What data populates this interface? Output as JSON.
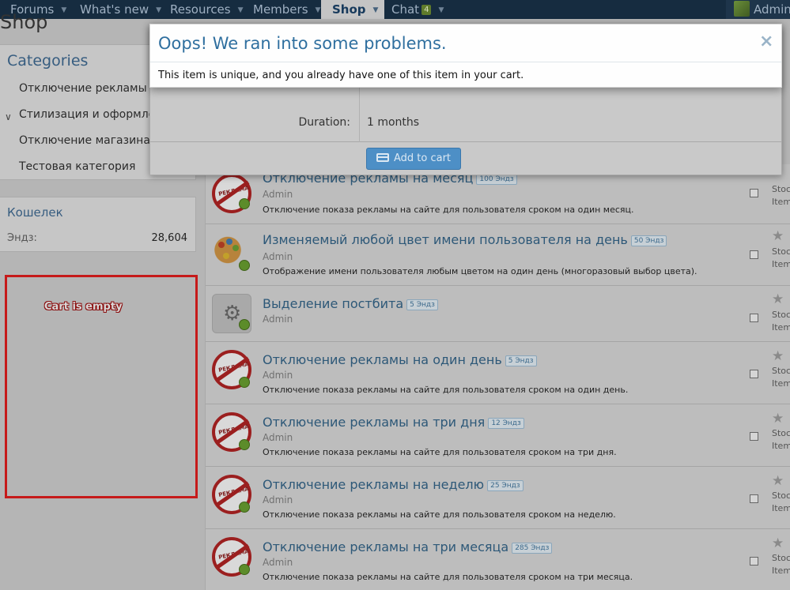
{
  "nav": {
    "tabs": [
      {
        "label": "Forums"
      },
      {
        "label": "What's new"
      },
      {
        "label": "Resources"
      },
      {
        "label": "Members"
      },
      {
        "label": "Shop",
        "active": true
      },
      {
        "label": "Chat",
        "badge": "4"
      }
    ],
    "user": "Admin"
  },
  "page": {
    "title": "Shop"
  },
  "sidebar": {
    "categories_title": "Categories",
    "categories": [
      "Отключение рекламы",
      "Стилизация и оформление",
      "Отключение магазина",
      "Тестовая категория"
    ],
    "wallet": {
      "title": "Кошелек",
      "currency_label": "Эндз:",
      "balance": "28,604"
    }
  },
  "cart": {
    "empty_text": "Cart is empty",
    "highlight_color": "#c61a1a"
  },
  "items": [
    {
      "title": "Отключение рекламы на месяц",
      "price": "100 Эндз",
      "author": "Admin",
      "description": "Отключение показа рекламы на сайте для пользователя сроком на один месяц.",
      "icon": "no-ads-icon"
    },
    {
      "title": "Изменяемый любой цвет имени пользователя на день",
      "price": "50 Эндз",
      "author": "Admin",
      "description": "Отображение имени пользователя любым цветом на один день (многоразовый выбор цвета).",
      "icon": "palette-icon"
    },
    {
      "title": "Выделение постбита",
      "price": "5 Эндз",
      "author": "Admin",
      "description": "",
      "icon": "gear-icon"
    },
    {
      "title": "Отключение рекламы на один день",
      "price": "5 Эндз",
      "author": "Admin",
      "description": "Отключение показа рекламы на сайте для пользователя сроком на один день.",
      "icon": "no-ads-icon"
    },
    {
      "title": "Отключение рекламы на три дня",
      "price": "12 Эндз",
      "author": "Admin",
      "description": "Отключение показа рекламы на сайте для пользователя сроком на три дня.",
      "icon": "no-ads-icon"
    },
    {
      "title": "Отключение рекламы на неделю",
      "price": "25 Эндз",
      "author": "Admin",
      "description": "Отключение показа рекламы на сайте для пользователя сроком на неделю.",
      "icon": "no-ads-icon"
    },
    {
      "title": "Отключение рекламы на три месяца",
      "price": "285 Эндз",
      "author": "Admin",
      "description": "Отключение показа рекламы на сайте для пользователя сроком на три месяца.",
      "icon": "no-ads-icon"
    }
  ],
  "item_side": {
    "stock": "Stoc",
    "items": "Item",
    "icon_ad_text": "РЕКЛАМА"
  },
  "purchase_dialog": {
    "duration_label": "Duration:",
    "duration_value": "1 months",
    "add_to_cart": "Add to cart"
  },
  "error": {
    "title": "Oops! We ran into some problems.",
    "message": "This item is unique, and you already have one of this item in your cart.",
    "close_symbol": "×"
  }
}
